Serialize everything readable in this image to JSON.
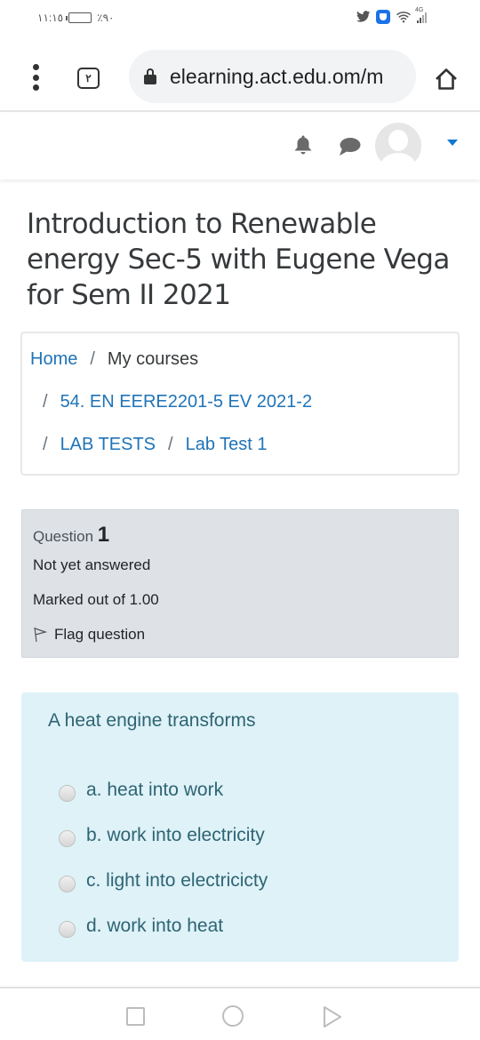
{
  "status_bar": {
    "time": "١١:١٥",
    "battery_percent_label": "٪٩٠",
    "battery_level": 0.9,
    "network_label": "4G",
    "icons": [
      "twitter-icon",
      "shield-app-icon",
      "wifi-icon",
      "signal-icon"
    ]
  },
  "browser": {
    "tab_count": "٢",
    "url": "elearning.act.edu.om/m",
    "icons": {
      "menu": "more-vert-icon",
      "lock": "lock-icon",
      "home": "home-icon"
    }
  },
  "navbar": {
    "icons": [
      "bell-icon",
      "chat-icon",
      "avatar",
      "caret-down-icon"
    ],
    "accent_color": "#1177d1"
  },
  "page": {
    "title": "Introduction to Renewable energy Sec-5 with Eugene Vega for Sem II 2021"
  },
  "breadcrumb": {
    "separator": "/",
    "items": [
      {
        "label": "Home",
        "link": true
      },
      {
        "label": "My courses",
        "link": false
      },
      {
        "label": "54. EN EERE2201-5 EV 2021-2",
        "link": true
      },
      {
        "label": "LAB TESTS",
        "link": true
      },
      {
        "label": "Lab Test 1",
        "link": true
      }
    ]
  },
  "question_info": {
    "label": "Question",
    "number": "1",
    "state": "Not yet answered",
    "grade": "Marked out of 1.00",
    "flag_label": "Flag question"
  },
  "question": {
    "text": "A heat engine transforms",
    "answers": [
      {
        "label": "a. heat into work",
        "selected": false
      },
      {
        "label": "b. work into electricity",
        "selected": false
      },
      {
        "label": "c. light into electricicty",
        "selected": false
      },
      {
        "label": "d. work into heat",
        "selected": false
      }
    ]
  },
  "colors": {
    "link": "#1f73b7",
    "info_bg": "#dee2e6",
    "content_bg": "#def2f8",
    "content_text": "#2f6473"
  },
  "system_nav": {
    "buttons": [
      "recents-icon",
      "home-circle-icon",
      "back-icon"
    ]
  }
}
